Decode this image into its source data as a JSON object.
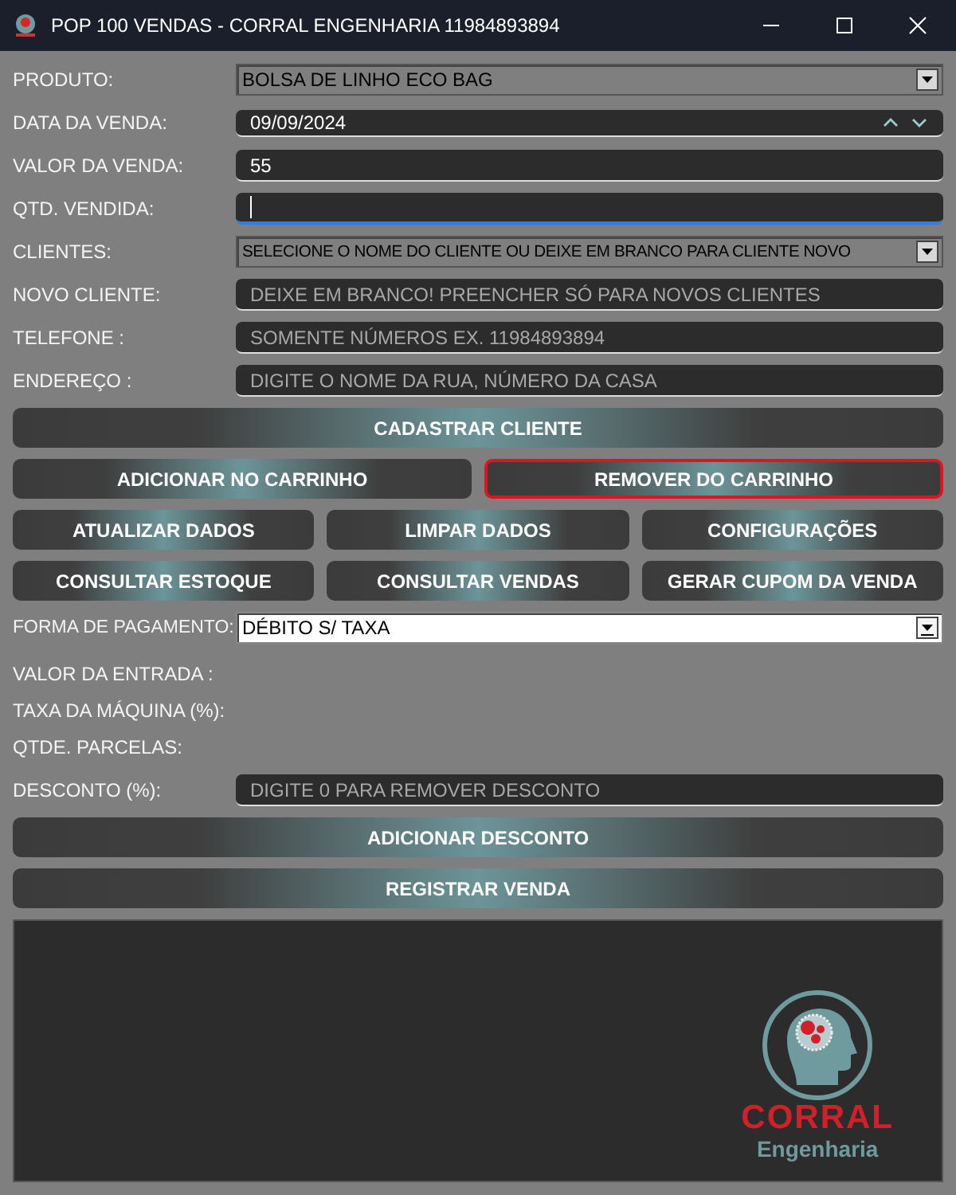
{
  "window": {
    "title": "POP 100 VENDAS - CORRAL ENGENHARIA 11984893894"
  },
  "fields": [
    {
      "label": "PRODUTO:",
      "kind": "combo",
      "value": "BOLSA DE LINHO ECO BAG"
    },
    {
      "label": "DATA DA VENDA:",
      "kind": "date",
      "value": "09/09/2024"
    },
    {
      "label": "VALOR DA VENDA:",
      "kind": "input",
      "value": "55"
    },
    {
      "label": "QTD. VENDIDA:",
      "kind": "input",
      "focused": true
    },
    {
      "label": "CLIENTES:",
      "kind": "combo",
      "value": "SELECIONE O NOME DO CLIENTE OU DEIXE EM BRANCO PARA CLIENTE NOVO"
    },
    {
      "label": "NOVO CLIENTE:",
      "kind": "input",
      "placeholder": "DEIXE EM BRANCO! PREENCHER SÓ PARA NOVOS CLIENTES"
    },
    {
      "label": "TELEFONE :",
      "kind": "input",
      "placeholder": "SOMENTE NÚMEROS EX. 11984893894"
    },
    {
      "label": "ENDEREÇO :",
      "kind": "input",
      "placeholder": "DIGITE O NOME DA RUA, NÚMERO DA CASA"
    }
  ],
  "button_rows": [
    [
      {
        "label": "CADASTRAR CLIENTE",
        "outlined": false
      }
    ],
    [
      {
        "label": "ADICIONAR NO CARRINHO",
        "outlined": false
      },
      {
        "label": "REMOVER DO CARRINHO",
        "outlined": true
      }
    ],
    [
      {
        "label": "ATUALIZAR DADOS",
        "outlined": false
      },
      {
        "label": "LIMPAR DADOS",
        "outlined": false
      },
      {
        "label": "CONFIGURAÇÕES",
        "outlined": false
      }
    ],
    [
      {
        "label": "CONSULTAR ESTOQUE",
        "outlined": false
      },
      {
        "label": "CONSULTAR VENDAS",
        "outlined": false
      },
      {
        "label": "GERAR CUPOM DA VENDA",
        "outlined": false
      }
    ]
  ],
  "payment": {
    "label": "FORMA DE PAGAMENTO:",
    "value": "DÉBITO S/ TAXA"
  },
  "info_labels": [
    "VALOR DA ENTRADA :",
    "TAXA DA MÁQUINA (%):",
    "QTDE. PARCELAS:"
  ],
  "discount": {
    "label": "DESCONTO (%):",
    "placeholder": "DIGITE 0 PARA REMOVER DESCONTO"
  },
  "bottom_buttons": [
    {
      "label": "ADICIONAR DESCONTO",
      "outlined": false
    },
    {
      "label": "REGISTRAR VENDA",
      "outlined": false
    }
  ],
  "logo": {
    "name": "CORRAL",
    "subtitle": "Engenharia"
  }
}
